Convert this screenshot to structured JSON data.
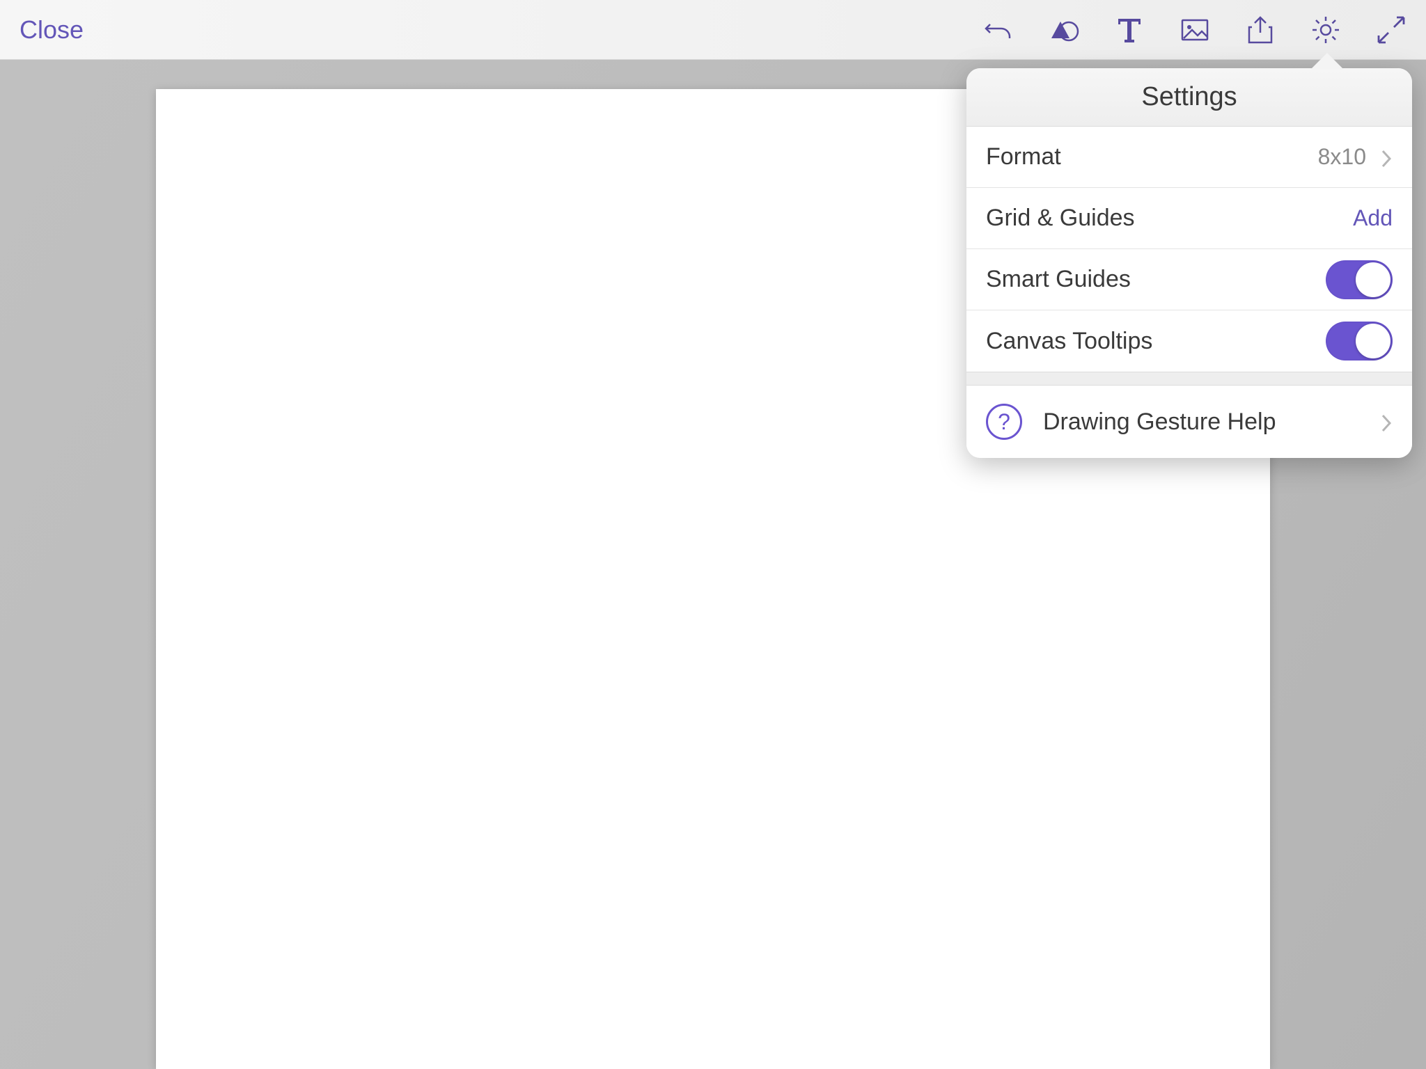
{
  "toolbar": {
    "close_label": "Close"
  },
  "popover": {
    "title": "Settings",
    "format": {
      "label": "Format",
      "value": "8x10"
    },
    "grid_guides": {
      "label": "Grid & Guides",
      "action": "Add"
    },
    "smart_guides": {
      "label": "Smart Guides",
      "on": true
    },
    "canvas_tooltips": {
      "label": "Canvas Tooltips",
      "on": true
    },
    "help": {
      "label": "Drawing Gesture Help"
    }
  },
  "colors": {
    "accent": "#6a54d0",
    "link": "#6356b8"
  }
}
